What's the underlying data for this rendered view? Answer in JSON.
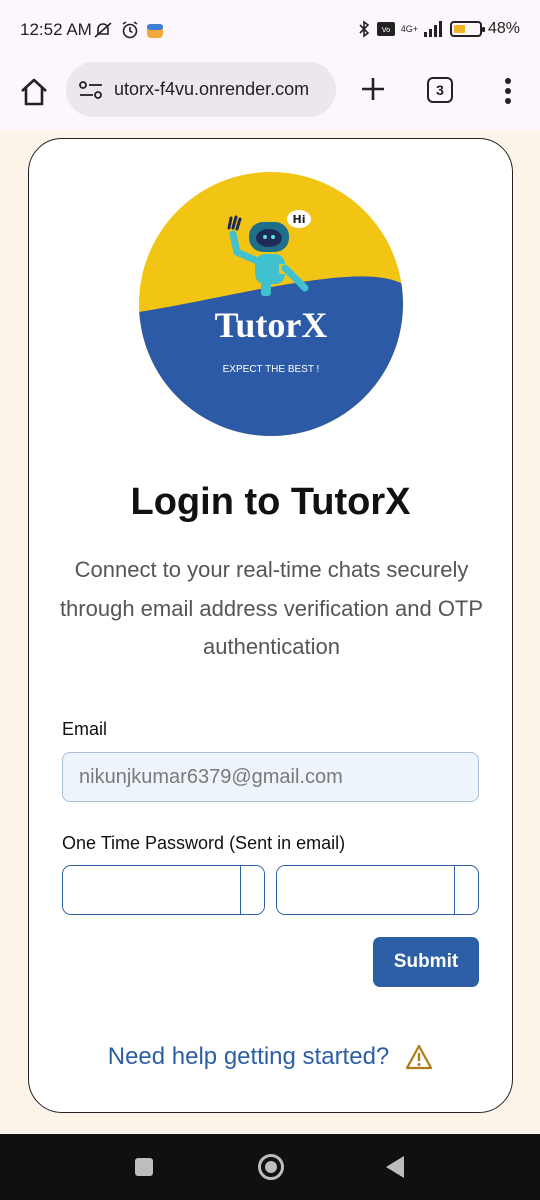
{
  "status_bar": {
    "time": "12:52 AM",
    "network": "4G+",
    "battery_text": "48%",
    "battery_level": 0.48
  },
  "browser": {
    "url": "utorx-f4vu.onrender.com",
    "tab_count": "3"
  },
  "logo": {
    "brand": "TutorX",
    "tagline": "EXPECT THE BEST !",
    "speech": "Hi",
    "colors": {
      "yellow": "#f2c514",
      "blue": "#2d5aa6"
    }
  },
  "login": {
    "title": "Login to TutorX",
    "description": "Connect to your real-time chats securely through email address verification and OTP authentication",
    "email_label": "Email",
    "email_value": "nikunjkumar6379@gmail.com",
    "otp_label": "One Time Password (Sent in email)",
    "submit_label": "Submit",
    "help_text": "Need help getting started?"
  },
  "colors": {
    "accent": "#2d5fa6",
    "page_bg": "#fcf4e8",
    "warning": "#b07a16"
  }
}
